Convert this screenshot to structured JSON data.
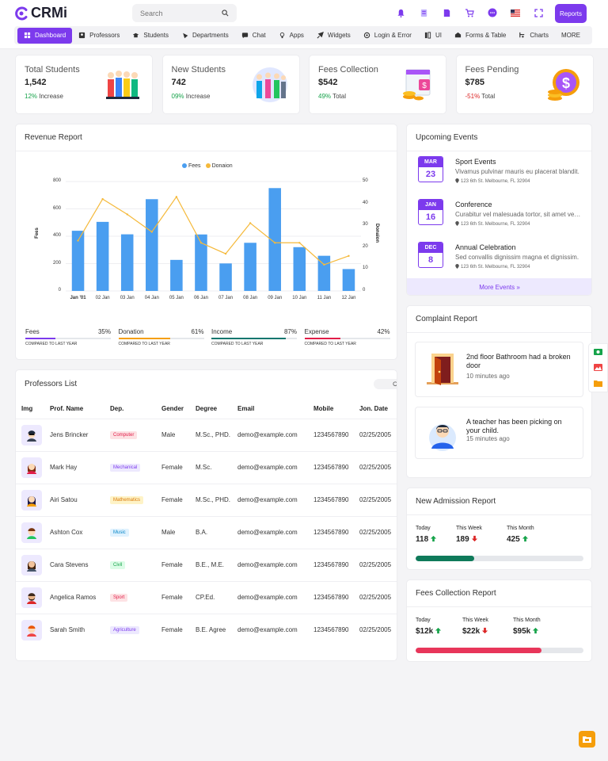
{
  "brand": {
    "name": "CRMi"
  },
  "search": {
    "placeholder": "Search"
  },
  "header": {
    "reports_label": "Reports"
  },
  "nav": [
    {
      "label": "Dashboard",
      "icon": "dashboard-icon"
    },
    {
      "label": "Professors",
      "icon": "professor-icon"
    },
    {
      "label": "Students",
      "icon": "student-icon"
    },
    {
      "label": "Departments",
      "icon": "department-icon"
    },
    {
      "label": "Chat",
      "icon": "chat-icon"
    },
    {
      "label": "Apps",
      "icon": "apps-icon"
    },
    {
      "label": "Widgets",
      "icon": "widgets-icon"
    },
    {
      "label": "Login & Error",
      "icon": "login-icon"
    },
    {
      "label": "UI",
      "icon": "ui-icon"
    },
    {
      "label": "Forms & Table",
      "icon": "forms-icon"
    },
    {
      "label": "Charts",
      "icon": "charts-icon"
    },
    {
      "label": "MORE",
      "icon": ""
    }
  ],
  "stats": [
    {
      "title": "Total Students",
      "value": "1,542",
      "change": "12%",
      "suffix": "Increase",
      "trend": "pos"
    },
    {
      "title": "New Students",
      "value": "742",
      "change": "09%",
      "suffix": "Increase",
      "trend": "pos"
    },
    {
      "title": "Fees Collection",
      "value": "$542",
      "change": "49%",
      "suffix": "Total",
      "trend": "pos"
    },
    {
      "title": "Fees Pending",
      "value": "$785",
      "change": "-51%",
      "suffix": "Total",
      "trend": "neg"
    }
  ],
  "revenue": {
    "title": "Revenue Report",
    "progress": [
      {
        "label": "Fees",
        "percent": "35%",
        "value": 35,
        "color": "#7c3aed",
        "note": "COMPARED TO LAST YEAR"
      },
      {
        "label": "Donation",
        "percent": "61%",
        "value": 61,
        "color": "#f59e0b",
        "note": "COMPARED TO LAST YEAR"
      },
      {
        "label": "Income",
        "percent": "87%",
        "value": 87,
        "color": "#0f766e",
        "note": "COMPARED TO LAST YEAR"
      },
      {
        "label": "Expense",
        "percent": "42%",
        "value": 42,
        "color": "#e11d48",
        "note": "COMPARED TO LAST YEAR"
      }
    ]
  },
  "chart_data": {
    "type": "bar",
    "title": "",
    "categories": [
      "Jan '01",
      "02 Jan",
      "03 Jan",
      "04 Jan",
      "05 Jan",
      "06 Jan",
      "07 Jan",
      "08 Jan",
      "09 Jan",
      "10 Jan",
      "11 Jan",
      "12 Jan"
    ],
    "series": [
      {
        "name": "Fees",
        "type": "bar",
        "axis": "left",
        "color": "#4a9ef0",
        "values": [
          440,
          505,
          414,
          671,
          227,
          413,
          201,
          352,
          752,
          320,
          257,
          160
        ]
      },
      {
        "name": "Donaion",
        "type": "line",
        "axis": "right",
        "color": "#f5b93a",
        "values": [
          23,
          42,
          35,
          27,
          43,
          22,
          17,
          31,
          22,
          22,
          12,
          16
        ]
      }
    ],
    "ylabel": "Fees",
    "y2label": "Donaion",
    "ylim": [
      0,
      800
    ],
    "y2lim": [
      0,
      50
    ],
    "yticks": [
      0,
      200,
      400,
      600,
      800
    ],
    "y2ticks": [
      0,
      10,
      20,
      30,
      40,
      50
    ],
    "legend": "top-center",
    "grid": true
  },
  "professors": {
    "title": "Professors List",
    "columns": [
      "Img",
      "Prof. Name",
      "Dep.",
      "Gender",
      "Degree",
      "Email",
      "Mobile",
      "Jon. Date"
    ],
    "rows": [
      {
        "name": "Jens Brincker",
        "dep": "Computer",
        "dep_bg": "#fde2e4",
        "dep_fg": "#e11d48",
        "gender": "Male",
        "degree": "M.Sc., PHD.",
        "email": "demo@example.com",
        "mobile": "1234567890",
        "date": "02/25/2005",
        "avatar": "male-glasses-avatar-icon"
      },
      {
        "name": "Mark Hay",
        "dep": "Mechanical",
        "dep_bg": "#ede9fe",
        "dep_fg": "#7c3aed",
        "gender": "Female",
        "degree": "M.Sc.",
        "email": "demo@example.com",
        "mobile": "1234567890",
        "date": "02/25/2005",
        "avatar": "female-red-avatar-icon"
      },
      {
        "name": "Airi Satou",
        "dep": "Mathematics",
        "dep_bg": "#fef3c7",
        "dep_fg": "#d97706",
        "gender": "Female",
        "degree": "M.Sc., PHD.",
        "email": "demo@example.com",
        "mobile": "1234567890",
        "date": "02/25/2005",
        "avatar": "female-dark-hair-avatar-icon"
      },
      {
        "name": "Ashton Cox",
        "dep": "Music",
        "dep_bg": "#e0f2fe",
        "dep_fg": "#0284c7",
        "gender": "Male",
        "degree": "B.A.",
        "email": "demo@example.com",
        "mobile": "1234567890",
        "date": "02/25/2005",
        "avatar": "male-green-avatar-icon"
      },
      {
        "name": "Cara Stevens",
        "dep": "Civil",
        "dep_bg": "#dcfce7",
        "dep_fg": "#16a34a",
        "gender": "Female",
        "degree": "B.E., M.E.",
        "email": "demo@example.com",
        "mobile": "1234567890",
        "date": "02/25/2005",
        "avatar": "female-brown-avatar-icon"
      },
      {
        "name": "Angelica Ramos",
        "dep": "Sport",
        "dep_bg": "#fde2e4",
        "dep_fg": "#e11d48",
        "gender": "Female",
        "degree": "CP.Ed.",
        "email": "demo@example.com",
        "mobile": "1234567890",
        "date": "02/25/2005",
        "avatar": "male-beard-avatar-icon"
      },
      {
        "name": "Sarah Smith",
        "dep": "Agriculture",
        "dep_bg": "#ede9fe",
        "dep_fg": "#7c3aed",
        "gender": "Female",
        "degree": "B.E. Agree",
        "email": "demo@example.com",
        "mobile": "1234567890",
        "date": "02/25/2005",
        "avatar": "male-red-hair-avatar-icon"
      }
    ]
  },
  "events": {
    "title": "Upcoming Events",
    "items": [
      {
        "month": "MAR",
        "day": "23",
        "title": "Sport Events",
        "desc": "Vivamus pulvinar mauris eu placerat blandit.",
        "loc": "123 6th St. Melbourne, FL 32904"
      },
      {
        "month": "JAN",
        "day": "16",
        "title": "Conference",
        "desc": "Curabitur vel malesuada tortor, sit amet vestibulum.",
        "loc": "123 6th St. Melbourne, FL 32904"
      },
      {
        "month": "DEC",
        "day": "8",
        "title": "Annual Celebration",
        "desc": "Sed convallis dignissim magna et dignissim.",
        "loc": "123 6th St. Melbourne, FL 32904"
      }
    ],
    "more_label": "More Events »"
  },
  "complaints": {
    "title": "Complaint Report",
    "items": [
      {
        "text": "2nd floor Bathroom had a broken door",
        "time": "10 minutes ago"
      },
      {
        "text": "A teacher has been picking on your child.",
        "time": "15 minutes ago"
      }
    ]
  },
  "admission": {
    "title": "New Admission Report",
    "items": [
      {
        "label": "Today",
        "value": "118",
        "trend": "up"
      },
      {
        "label": "This Week",
        "value": "189",
        "trend": "down"
      },
      {
        "label": "This Month",
        "value": "425",
        "trend": "up"
      }
    ],
    "progress": 0.35,
    "color": "#0f7a5a"
  },
  "fees_report": {
    "title": "Fees Collection Report",
    "items": [
      {
        "label": "Today",
        "value": "$12k",
        "trend": "up"
      },
      {
        "label": "This Week",
        "value": "$22k",
        "trend": "down"
      },
      {
        "label": "This Month",
        "value": "$95k",
        "trend": "up"
      }
    ],
    "progress": 0.75,
    "color": "#e8365a"
  }
}
